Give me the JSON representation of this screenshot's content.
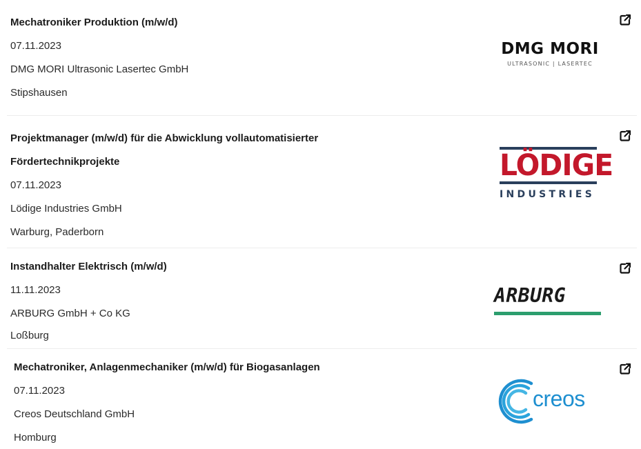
{
  "jobs": [
    {
      "title": "Mechatroniker Produktion (m/w/d)",
      "date": "07.11.2023",
      "company": "DMG MORI Ultrasonic Lasertec GmbH",
      "location": "Stipshausen",
      "logo": {
        "main": "DMG MORI",
        "sub": "ULTRASONIC | LASERTEC"
      }
    },
    {
      "title": "Projektmanager (m/w/d) für die Abwicklung vollautomatisierter Fördertechnikprojekte",
      "date": "07.11.2023",
      "company": "Lödige Industries GmbH",
      "location": "Warburg, Paderborn",
      "logo": {
        "main": "LÖDIGE",
        "sub": "INDUSTRIES"
      }
    },
    {
      "title": "Instandhalter Elektrisch (m/w/d)",
      "date": "11.11.2023",
      "company": "ARBURG GmbH + Co KG",
      "location": "Loßburg",
      "logo": {
        "main": "ARBURG"
      }
    },
    {
      "title": "Mechatroniker, Anlagenmechaniker (m/w/d) für Biogasanlagen",
      "date": "07.11.2023",
      "company": "Creos Deutschland GmbH",
      "location": "Homburg",
      "logo": {
        "main": "creos"
      }
    }
  ],
  "icons": {
    "external_link": "external-link-icon"
  },
  "colors": {
    "lodige_red": "#c3182b",
    "lodige_blue": "#2a3f5c",
    "arburg_green": "#2c9e6e",
    "creos_blue": "#1e8fd0"
  }
}
